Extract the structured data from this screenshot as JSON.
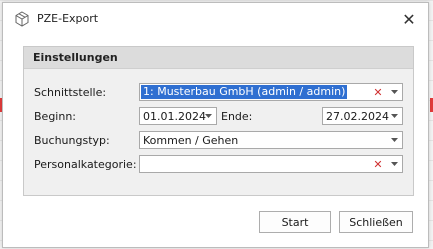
{
  "window": {
    "title": "PZE-Export"
  },
  "group": {
    "title": "Einstellungen"
  },
  "form": {
    "schnittstelle": {
      "label": "Schnittstelle:",
      "value": "1: Musterbau GmbH (admin / admin)"
    },
    "beginn": {
      "label": "Beginn:",
      "value": "01.01.2024"
    },
    "ende": {
      "label": "Ende:",
      "value": "27.02.2024"
    },
    "buchungstyp": {
      "label": "Buchungstyp:",
      "value": "Kommen / Gehen"
    },
    "personalkategorie": {
      "label": "Personalkategorie:",
      "value": ""
    }
  },
  "buttons": {
    "start": "Start",
    "close": "Schließen"
  },
  "icons": {
    "clear": "✕",
    "close": "✕"
  },
  "colors": {
    "selection": "#2f6fd1",
    "clear_icon": "#d03030"
  }
}
